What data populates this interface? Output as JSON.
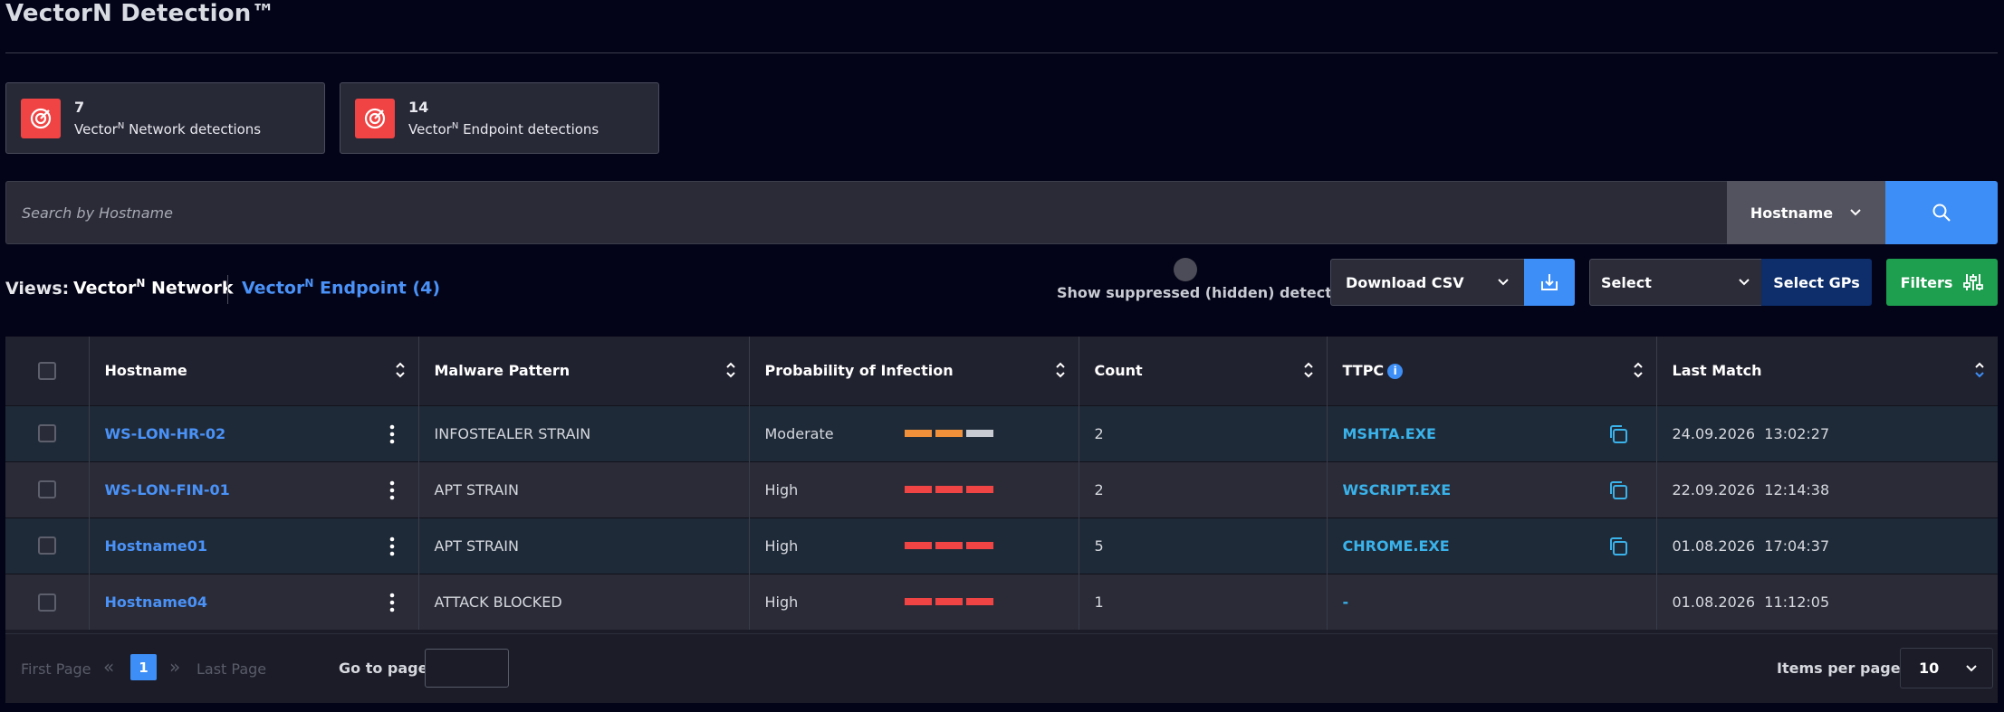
{
  "header": {
    "title": "VectorN Detection™"
  },
  "stats": [
    {
      "count": "7",
      "label_prefix": "Vector",
      "label_sup": "N",
      "label_suffix": " Network detections"
    },
    {
      "count": "14",
      "label_prefix": "Vector",
      "label_sup": "N",
      "label_suffix": " Endpoint detections"
    }
  ],
  "search": {
    "placeholder": "Search by Hostname",
    "field": "Hostname"
  },
  "views": {
    "label": "Views:",
    "network": {
      "prefix": "Vector",
      "sup": "N",
      "suffix": " Network"
    },
    "endpoint": {
      "prefix": "Vector",
      "sup": "N",
      "suffix": " Endpoint (4)"
    }
  },
  "toolbar": {
    "suppressed_label": "Show suppressed (hidden) detections",
    "download_label": "Download CSV",
    "gp_select_label": "Select",
    "select_gps_label": "Select GPs",
    "filters_label": "Filters"
  },
  "table": {
    "columns": [
      "Hostname",
      "Malware Pattern",
      "Probability of Infection",
      "Count",
      "TTPC",
      "Last Match"
    ],
    "rows": [
      {
        "hostname": "WS-LON-HR-02",
        "pattern": "INFOSTEALER STRAIN",
        "probability": "Moderate",
        "level": 2,
        "count": "2",
        "ttpc": "MSHTA.EXE",
        "copy": true,
        "last_match": "24.09.2026  13:02:27"
      },
      {
        "hostname": "WS-LON-FIN-01",
        "pattern": "APT STRAIN",
        "probability": "High",
        "level": 3,
        "count": "2",
        "ttpc": "WSCRIPT.EXE",
        "copy": true,
        "last_match": "22.09.2026  12:14:38"
      },
      {
        "hostname": "Hostname01",
        "pattern": "APT STRAIN",
        "probability": "High",
        "level": 3,
        "count": "5",
        "ttpc": "CHROME.EXE",
        "copy": true,
        "last_match": "01.08.2026  17:04:37"
      },
      {
        "hostname": "Hostname04",
        "pattern": "ATTACK BLOCKED",
        "probability": "High",
        "level": 3,
        "count": "1",
        "ttpc": "-",
        "copy": false,
        "last_match": "01.08.2026  11:12:05"
      }
    ]
  },
  "pagination": {
    "first": "First Page",
    "last": "Last Page",
    "current": "1",
    "goto_label": "Go to page:",
    "items_label": "Items per page:",
    "items_value": "10"
  },
  "colors": {
    "accent_blue": "#3d8ef6",
    "danger_red": "#f04444",
    "moderate_orange": "#f0903a",
    "bar_inactive": "#c9cbd3",
    "filters_green": "#1e9e4f",
    "gps_navy": "#0d2d6b"
  },
  "icons": {
    "stat": "target-icon",
    "search": "search-icon",
    "download": "download-icon",
    "filters": "sliders-icon",
    "copy": "copy-icon",
    "info": "info-icon",
    "kebab": "kebab-icon",
    "sort": "sort-icon"
  }
}
